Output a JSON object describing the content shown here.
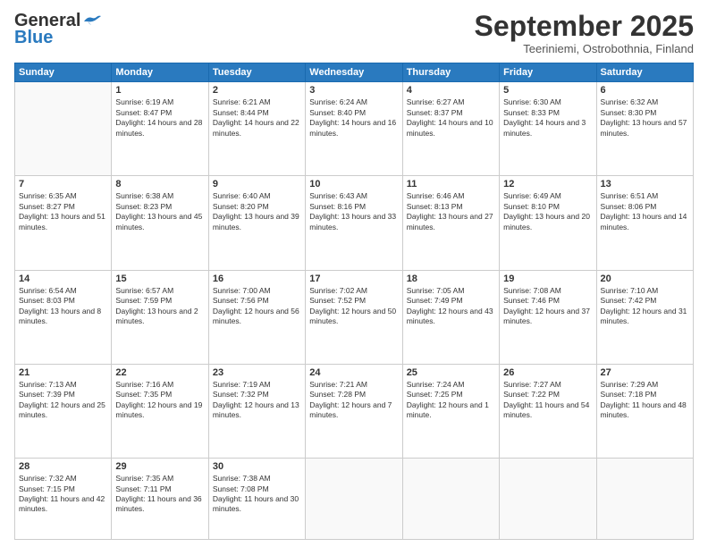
{
  "header": {
    "logo_general": "General",
    "logo_blue": "Blue",
    "month_title": "September 2025",
    "location": "Teeriniemi, Ostrobothnia, Finland"
  },
  "weekdays": [
    "Sunday",
    "Monday",
    "Tuesday",
    "Wednesday",
    "Thursday",
    "Friday",
    "Saturday"
  ],
  "weeks": [
    [
      {
        "day": "",
        "sunrise": "",
        "sunset": "",
        "daylight": ""
      },
      {
        "day": "1",
        "sunrise": "Sunrise: 6:19 AM",
        "sunset": "Sunset: 8:47 PM",
        "daylight": "Daylight: 14 hours and 28 minutes."
      },
      {
        "day": "2",
        "sunrise": "Sunrise: 6:21 AM",
        "sunset": "Sunset: 8:44 PM",
        "daylight": "Daylight: 14 hours and 22 minutes."
      },
      {
        "day": "3",
        "sunrise": "Sunrise: 6:24 AM",
        "sunset": "Sunset: 8:40 PM",
        "daylight": "Daylight: 14 hours and 16 minutes."
      },
      {
        "day": "4",
        "sunrise": "Sunrise: 6:27 AM",
        "sunset": "Sunset: 8:37 PM",
        "daylight": "Daylight: 14 hours and 10 minutes."
      },
      {
        "day": "5",
        "sunrise": "Sunrise: 6:30 AM",
        "sunset": "Sunset: 8:33 PM",
        "daylight": "Daylight: 14 hours and 3 minutes."
      },
      {
        "day": "6",
        "sunrise": "Sunrise: 6:32 AM",
        "sunset": "Sunset: 8:30 PM",
        "daylight": "Daylight: 13 hours and 57 minutes."
      }
    ],
    [
      {
        "day": "7",
        "sunrise": "Sunrise: 6:35 AM",
        "sunset": "Sunset: 8:27 PM",
        "daylight": "Daylight: 13 hours and 51 minutes."
      },
      {
        "day": "8",
        "sunrise": "Sunrise: 6:38 AM",
        "sunset": "Sunset: 8:23 PM",
        "daylight": "Daylight: 13 hours and 45 minutes."
      },
      {
        "day": "9",
        "sunrise": "Sunrise: 6:40 AM",
        "sunset": "Sunset: 8:20 PM",
        "daylight": "Daylight: 13 hours and 39 minutes."
      },
      {
        "day": "10",
        "sunrise": "Sunrise: 6:43 AM",
        "sunset": "Sunset: 8:16 PM",
        "daylight": "Daylight: 13 hours and 33 minutes."
      },
      {
        "day": "11",
        "sunrise": "Sunrise: 6:46 AM",
        "sunset": "Sunset: 8:13 PM",
        "daylight": "Daylight: 13 hours and 27 minutes."
      },
      {
        "day": "12",
        "sunrise": "Sunrise: 6:49 AM",
        "sunset": "Sunset: 8:10 PM",
        "daylight": "Daylight: 13 hours and 20 minutes."
      },
      {
        "day": "13",
        "sunrise": "Sunrise: 6:51 AM",
        "sunset": "Sunset: 8:06 PM",
        "daylight": "Daylight: 13 hours and 14 minutes."
      }
    ],
    [
      {
        "day": "14",
        "sunrise": "Sunrise: 6:54 AM",
        "sunset": "Sunset: 8:03 PM",
        "daylight": "Daylight: 13 hours and 8 minutes."
      },
      {
        "day": "15",
        "sunrise": "Sunrise: 6:57 AM",
        "sunset": "Sunset: 7:59 PM",
        "daylight": "Daylight: 13 hours and 2 minutes."
      },
      {
        "day": "16",
        "sunrise": "Sunrise: 7:00 AM",
        "sunset": "Sunset: 7:56 PM",
        "daylight": "Daylight: 12 hours and 56 minutes."
      },
      {
        "day": "17",
        "sunrise": "Sunrise: 7:02 AM",
        "sunset": "Sunset: 7:52 PM",
        "daylight": "Daylight: 12 hours and 50 minutes."
      },
      {
        "day": "18",
        "sunrise": "Sunrise: 7:05 AM",
        "sunset": "Sunset: 7:49 PM",
        "daylight": "Daylight: 12 hours and 43 minutes."
      },
      {
        "day": "19",
        "sunrise": "Sunrise: 7:08 AM",
        "sunset": "Sunset: 7:46 PM",
        "daylight": "Daylight: 12 hours and 37 minutes."
      },
      {
        "day": "20",
        "sunrise": "Sunrise: 7:10 AM",
        "sunset": "Sunset: 7:42 PM",
        "daylight": "Daylight: 12 hours and 31 minutes."
      }
    ],
    [
      {
        "day": "21",
        "sunrise": "Sunrise: 7:13 AM",
        "sunset": "Sunset: 7:39 PM",
        "daylight": "Daylight: 12 hours and 25 minutes."
      },
      {
        "day": "22",
        "sunrise": "Sunrise: 7:16 AM",
        "sunset": "Sunset: 7:35 PM",
        "daylight": "Daylight: 12 hours and 19 minutes."
      },
      {
        "day": "23",
        "sunrise": "Sunrise: 7:19 AM",
        "sunset": "Sunset: 7:32 PM",
        "daylight": "Daylight: 12 hours and 13 minutes."
      },
      {
        "day": "24",
        "sunrise": "Sunrise: 7:21 AM",
        "sunset": "Sunset: 7:28 PM",
        "daylight": "Daylight: 12 hours and 7 minutes."
      },
      {
        "day": "25",
        "sunrise": "Sunrise: 7:24 AM",
        "sunset": "Sunset: 7:25 PM",
        "daylight": "Daylight: 12 hours and 1 minute."
      },
      {
        "day": "26",
        "sunrise": "Sunrise: 7:27 AM",
        "sunset": "Sunset: 7:22 PM",
        "daylight": "Daylight: 11 hours and 54 minutes."
      },
      {
        "day": "27",
        "sunrise": "Sunrise: 7:29 AM",
        "sunset": "Sunset: 7:18 PM",
        "daylight": "Daylight: 11 hours and 48 minutes."
      }
    ],
    [
      {
        "day": "28",
        "sunrise": "Sunrise: 7:32 AM",
        "sunset": "Sunset: 7:15 PM",
        "daylight": "Daylight: 11 hours and 42 minutes."
      },
      {
        "day": "29",
        "sunrise": "Sunrise: 7:35 AM",
        "sunset": "Sunset: 7:11 PM",
        "daylight": "Daylight: 11 hours and 36 minutes."
      },
      {
        "day": "30",
        "sunrise": "Sunrise: 7:38 AM",
        "sunset": "Sunset: 7:08 PM",
        "daylight": "Daylight: 11 hours and 30 minutes."
      },
      {
        "day": "",
        "sunrise": "",
        "sunset": "",
        "daylight": ""
      },
      {
        "day": "",
        "sunrise": "",
        "sunset": "",
        "daylight": ""
      },
      {
        "day": "",
        "sunrise": "",
        "sunset": "",
        "daylight": ""
      },
      {
        "day": "",
        "sunrise": "",
        "sunset": "",
        "daylight": ""
      }
    ]
  ]
}
